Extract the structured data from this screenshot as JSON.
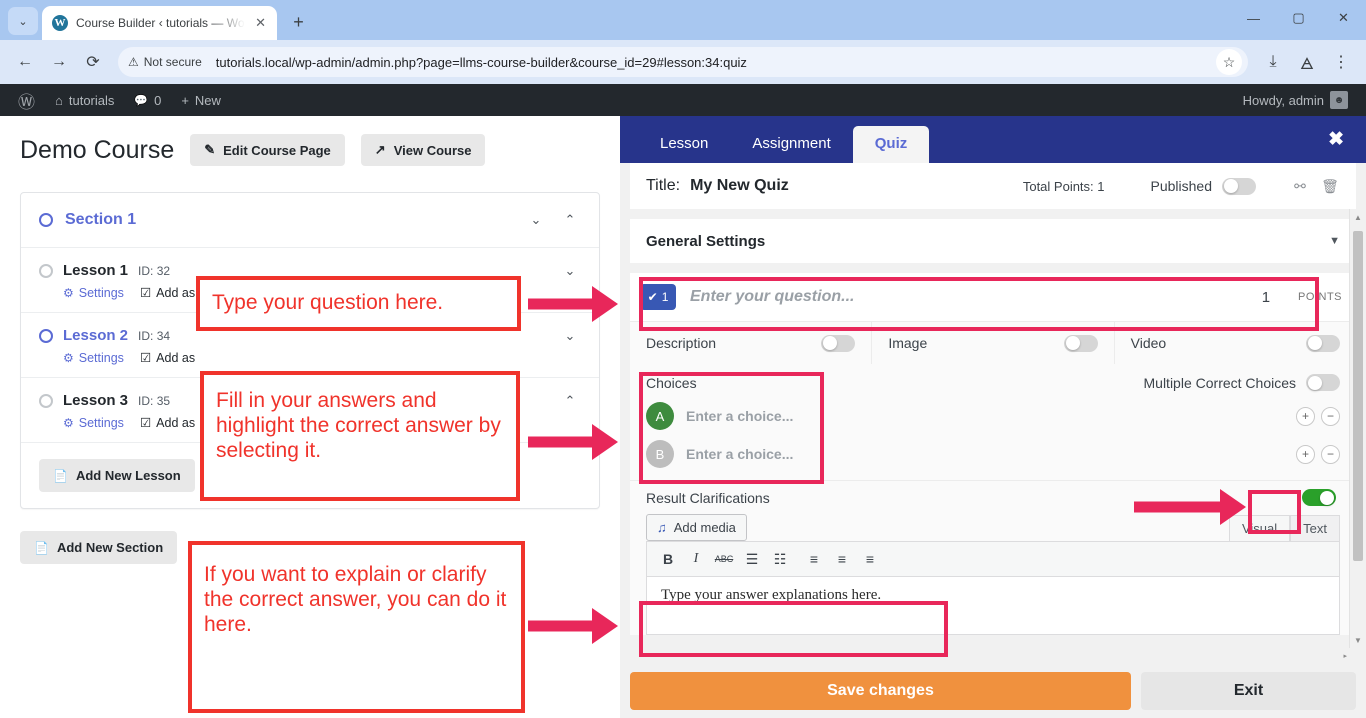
{
  "browser": {
    "tab_title": "Course Builder ‹ tutorials — Wo",
    "tab_close": "✕",
    "new_tab": "+",
    "favicon_letter": "W",
    "chevron": "⌄",
    "back": "←",
    "forward": "→",
    "reload": "⟳",
    "security_label": "Not secure",
    "security_icon": "⚠",
    "url": "tutorials.local/wp-admin/admin.php?page=llms-course-builder&course_id=29#lesson:34:quiz",
    "star": "☆",
    "download_icon": "⤓",
    "extension_icon": "🜁",
    "menu_icon": "⋮",
    "minimize": "—",
    "maximize": "▢",
    "close": "✕"
  },
  "adminbar": {
    "wp_logo": "Ⓦ",
    "site_icon": "⌂",
    "site_name": "tutorials",
    "comment_icon": "💬",
    "comment_count": "0",
    "new_plus": "+",
    "new_label": "New",
    "howdy": "Howdy, admin"
  },
  "course": {
    "title": "Demo Course",
    "edit_button": "Edit Course Page",
    "edit_icon": "✎",
    "view_button": "View Course",
    "view_icon": "↗",
    "section": {
      "name": "Section 1",
      "caret_down": "⌄",
      "caret_up": "⌃"
    },
    "lessons": [
      {
        "name": "Lesson 1",
        "id_label": "ID: 32",
        "settings": "Settings",
        "settings_icon": "⚙",
        "add_as": "Add as",
        "add_as_icon": "☑",
        "caret": "⌄",
        "highlighted": false
      },
      {
        "name": "Lesson 2",
        "id_label": "ID: 34",
        "settings": "Settings",
        "settings_icon": "⚙",
        "add_as": "Add as",
        "add_as_icon": "☑",
        "caret": "⌄",
        "highlighted": true
      },
      {
        "name": "Lesson 3",
        "id_label": "ID: 35",
        "settings": "Settings",
        "settings_icon": "⚙",
        "add_as": "Add as",
        "add_as_icon": "☑",
        "caret": "⌃",
        "highlighted": false
      }
    ],
    "add_new_lesson": "Add New Lesson",
    "add_new_section": "Add New Section",
    "page_icon": "📄"
  },
  "quiz": {
    "tabs": [
      {
        "label": "Lesson",
        "active": false
      },
      {
        "label": "Assignment",
        "active": false
      },
      {
        "label": "Quiz",
        "active": true
      }
    ],
    "close_icon": "✖",
    "title_label": "Title:",
    "title_value": "My New Quiz",
    "total_points": "Total Points: 1",
    "published_label": "Published",
    "published_on": false,
    "unlink_icon": "⚯",
    "trash_icon": "🗑",
    "general_settings": "General Settings",
    "general_settings_caret": "▼",
    "question": {
      "number": "1",
      "check_icon": "✔",
      "placeholder": "Enter your question...",
      "points_value": "1",
      "points_label": "POINTS"
    },
    "dimension_toggles": [
      {
        "label": "Description",
        "on": false
      },
      {
        "label": "Image",
        "on": false
      },
      {
        "label": "Video",
        "on": false
      }
    ],
    "choices": {
      "label": "Choices",
      "multiple_correct_label": "Multiple Correct Choices",
      "multiple_correct_on": false,
      "items": [
        {
          "letter": "A",
          "placeholder": "Enter a choice...",
          "correct": true
        },
        {
          "letter": "B",
          "placeholder": "Enter a choice...",
          "correct": false
        }
      ],
      "add_icon": "+",
      "remove_icon": "−"
    },
    "result_clarifications": {
      "label": "Result Clarifications",
      "toggle_on": true,
      "add_media": "Add media",
      "add_media_icon": "♫",
      "visual_tab": "Visual",
      "text_tab": "Text",
      "editor_buttons": [
        "B",
        "I",
        "ABC",
        "☰",
        "☷",
        "≡",
        "≡",
        "≡"
      ],
      "editor_content": "Type your answer explanations here."
    },
    "save_button": "Save changes",
    "exit_button": "Exit",
    "scroll_up": "▲",
    "scroll_down": "▼",
    "scroll_right": "▸"
  },
  "annotations": [
    {
      "text": "Type your question here."
    },
    {
      "text": "Fill in your answers and highlight the correct answer by selecting it."
    },
    {
      "text": "If you want to explain or clarify the correct answer, you can do it here."
    }
  ],
  "colors": {
    "annotation_red": "#f0332b",
    "highlight_pink": "#e8275a",
    "quiz_header_blue": "#27348b",
    "save_orange": "#f0913e",
    "wp_blue": "#5b6bd4",
    "correct_green": "#3e8b3e"
  }
}
